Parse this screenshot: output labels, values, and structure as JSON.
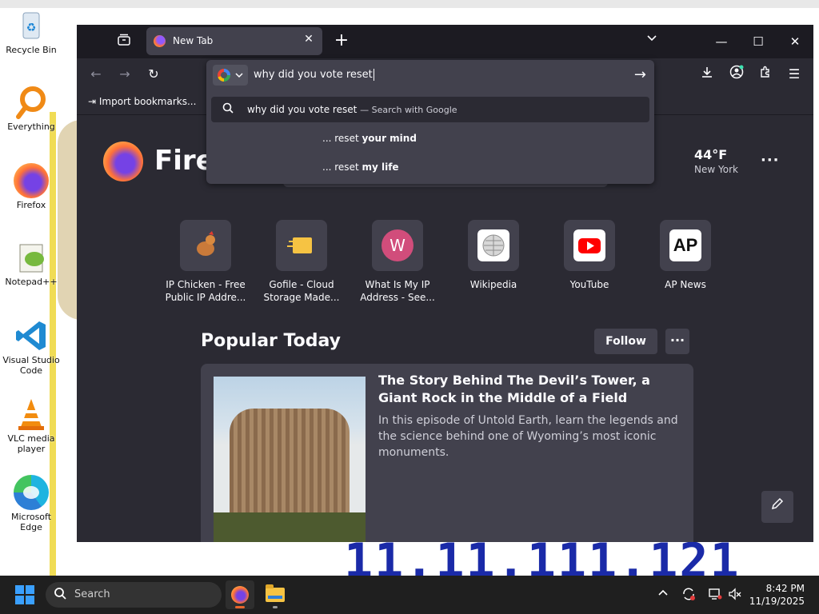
{
  "desktop": {
    "background_numbers": "11.11.111.121",
    "icons": [
      {
        "label": "Recycle Bin"
      },
      {
        "label": "Everything"
      },
      {
        "label": "Firefox"
      },
      {
        "label": "Notepad++"
      },
      {
        "label": "Visual Studio Code"
      },
      {
        "label": "VLC media player"
      },
      {
        "label": "Microsoft Edge"
      }
    ]
  },
  "browser": {
    "tab": {
      "title": "New Tab"
    },
    "bookmarks": {
      "import_label": "Import bookmarks..."
    },
    "urlbar": {
      "value": "why did you vote reset",
      "suggestions": [
        {
          "text": "why did you vote reset",
          "hint": "— Search with Google"
        },
        {
          "prefix": "... reset ",
          "bold": "your mind"
        },
        {
          "prefix": "... reset ",
          "bold": "my life"
        }
      ]
    },
    "newtab": {
      "wordmark": "Firef",
      "weather": {
        "temp": "44°F",
        "city": "New York"
      },
      "tiles": [
        {
          "name_line1": "IP Chicken - Free",
          "name_line2": "Public IP Addre..."
        },
        {
          "name_line1": "Gofile - Cloud",
          "name_line2": "Storage Made..."
        },
        {
          "name_line1": "What Is My IP",
          "name_line2": "Address - See...",
          "letter": "W"
        },
        {
          "name_line1": "Wikipedia",
          "name_line2": ""
        },
        {
          "name_line1": "YouTube",
          "name_line2": ""
        },
        {
          "name_line1": "AP News",
          "name_line2": "",
          "letter": "AP"
        }
      ],
      "popular": {
        "title": "Popular Today",
        "follow_label": "Follow",
        "story": {
          "title": "The Story Behind The Devil’s Tower, a Giant Rock in the Middle of a Field",
          "description": "In this episode of Untold Earth, learn the legends and the science behind one of Wyoming’s most iconic monuments."
        }
      }
    }
  },
  "taskbar": {
    "search_placeholder": "Search",
    "time": "8:42 PM",
    "date": "11/19/2025"
  },
  "colors": {
    "tab_strip": "#1c1b22",
    "toolbar": "#2b2a33",
    "popup": "#42414d",
    "text": "#fbfbfe",
    "taskbar": "#1f1f1f"
  }
}
